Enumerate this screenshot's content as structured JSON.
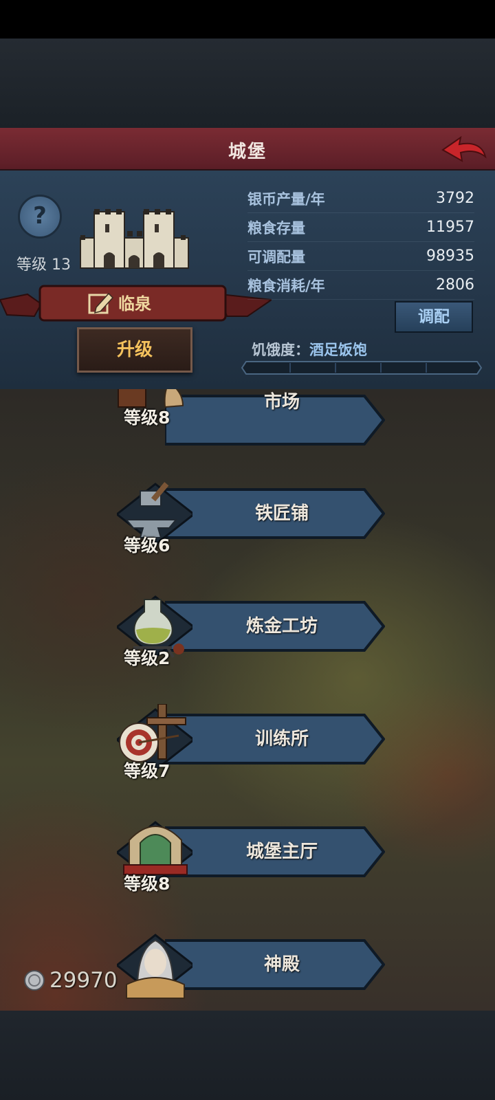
{
  "header": {
    "title": "城堡"
  },
  "castle": {
    "level_label": "等级 13",
    "name": "临泉",
    "upgrade_label": "升级"
  },
  "stats": [
    {
      "label": "银币产量/年",
      "value": "3792"
    },
    {
      "label": "粮食存量",
      "value": "11957"
    },
    {
      "label": "可调配量",
      "value": "98935"
    },
    {
      "label": "粮食消耗/年",
      "value": "2806"
    }
  ],
  "allocate_label": "调配",
  "hunger": {
    "label": "饥饿度：",
    "value": "酒足饭饱"
  },
  "buildings": [
    {
      "name": "市场",
      "level": "等级8",
      "icon": "market-icon"
    },
    {
      "name": "铁匠铺",
      "level": "等级6",
      "icon": "anvil-icon"
    },
    {
      "name": "炼金工坊",
      "level": "等级2",
      "icon": "flask-icon"
    },
    {
      "name": "训练所",
      "level": "等级7",
      "icon": "target-icon"
    },
    {
      "name": "城堡主厅",
      "level": "等级8",
      "icon": "hall-icon"
    },
    {
      "name": "神殿",
      "level": "",
      "icon": "priestess-icon"
    }
  ],
  "currency": {
    "silver": "29970"
  },
  "colors": {
    "title_bar": "#6b2530",
    "panel": "#263a4e",
    "upgrade_text": "#f5c25d",
    "accent_blue": "#9cc6ee"
  }
}
